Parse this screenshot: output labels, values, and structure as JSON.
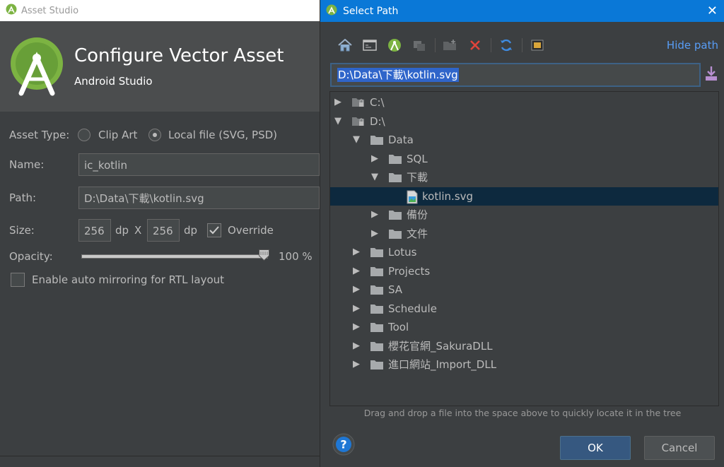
{
  "asset_window": {
    "title": "Asset Studio",
    "header_title": "Configure Vector Asset",
    "header_subtitle": "Android Studio",
    "asset_type_label": "Asset Type:",
    "asset_type_options": [
      "Clip Art",
      "Local file (SVG, PSD)"
    ],
    "asset_type_selected": "Local file (SVG, PSD)",
    "name_label": "Name:",
    "name_value": "ic_kotlin",
    "path_label": "Path:",
    "path_value": "D:\\Data\\下載\\kotlin.svg",
    "size_label": "Size:",
    "width_value": "256",
    "height_value": "256",
    "unit": "dp",
    "size_separator": "X",
    "override_label": "Override",
    "override_checked": true,
    "opacity_label": "Opacity:",
    "opacity_value": "100 %",
    "opacity_level": 1.0,
    "rtl_label": "Enable auto mirroring for RTL layout",
    "rtl_checked": false
  },
  "dialog": {
    "title": "Select Path",
    "hide_path": "Hide path",
    "path_text": "D:\\Data\\下載\\kotlin.svg",
    "toolbar": [
      "home-icon",
      "desktop-icon",
      "project-icon",
      "module-icon",
      "new-folder-icon",
      "delete-icon",
      "refresh-icon",
      "show-hidden-icon"
    ],
    "tree": [
      {
        "label": "C:\\",
        "depth": 0,
        "expanded": false,
        "kind": "drive"
      },
      {
        "label": "D:\\",
        "depth": 0,
        "expanded": true,
        "kind": "drive"
      },
      {
        "label": "Data",
        "depth": 1,
        "expanded": true,
        "kind": "folder"
      },
      {
        "label": "SQL",
        "depth": 2,
        "expanded": false,
        "kind": "folder"
      },
      {
        "label": "下載",
        "depth": 2,
        "expanded": true,
        "kind": "folder"
      },
      {
        "label": "kotlin.svg",
        "depth": 3,
        "expanded": null,
        "kind": "file",
        "selected": true
      },
      {
        "label": "備份",
        "depth": 2,
        "expanded": false,
        "kind": "folder"
      },
      {
        "label": "文件",
        "depth": 2,
        "expanded": false,
        "kind": "folder"
      },
      {
        "label": "Lotus",
        "depth": 1,
        "expanded": false,
        "kind": "folder"
      },
      {
        "label": "Projects",
        "depth": 1,
        "expanded": false,
        "kind": "folder"
      },
      {
        "label": "SA",
        "depth": 1,
        "expanded": false,
        "kind": "folder"
      },
      {
        "label": "Schedule",
        "depth": 1,
        "expanded": false,
        "kind": "folder"
      },
      {
        "label": "Tool",
        "depth": 1,
        "expanded": false,
        "kind": "folder"
      },
      {
        "label": "櫻花官網_SakuraDLL",
        "depth": 1,
        "expanded": false,
        "kind": "folder"
      },
      {
        "label": "進口網站_Import_DLL",
        "depth": 1,
        "expanded": false,
        "kind": "folder"
      }
    ],
    "drop_hint": "Drag and drop a file into the space above to quickly locate it in the tree",
    "ok_label": "OK",
    "cancel_label": "Cancel"
  },
  "colors": {
    "titlebar_active": "#0a78d7",
    "selection_row": "#0d293e",
    "link": "#589df6",
    "ok_button": "#365880"
  }
}
